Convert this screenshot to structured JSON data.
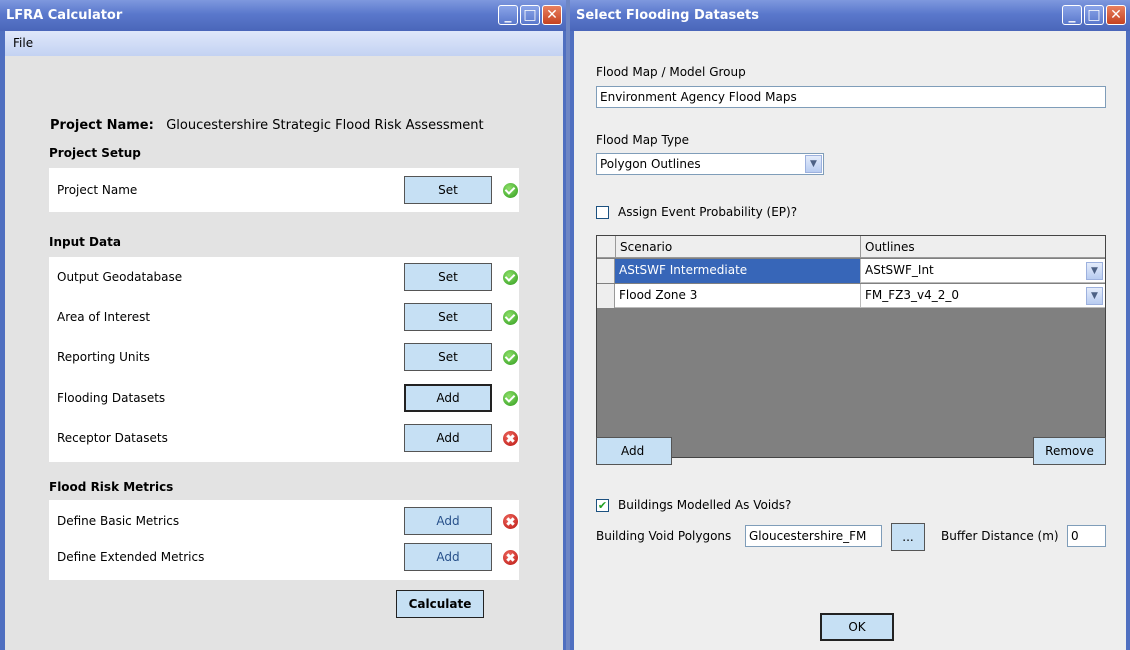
{
  "left": {
    "title": "LFRA Calculator",
    "menu": {
      "file": "File"
    },
    "project_name_label": "Project Name:",
    "project_name_value": "Gloucestershire Strategic Flood Risk Assessment",
    "sections": {
      "setup": "Project Setup",
      "input": "Input Data",
      "metrics": "Flood Risk Metrics"
    },
    "setup_rows": [
      {
        "label": "Project Name",
        "button": "Set",
        "status": "ok"
      }
    ],
    "input_rows": [
      {
        "label": "Output Geodatabase",
        "button": "Set",
        "status": "ok"
      },
      {
        "label": "Area of Interest",
        "button": "Set",
        "status": "ok"
      },
      {
        "label": "Reporting Units",
        "button": "Set",
        "status": "ok"
      },
      {
        "label": "Flooding Datasets",
        "button": "Add",
        "status": "ok"
      },
      {
        "label": "Receptor Datasets",
        "button": "Add",
        "status": "error"
      }
    ],
    "metric_rows": [
      {
        "label": "Define Basic Metrics",
        "button": "Add",
        "status": "error"
      },
      {
        "label": "Define Extended Metrics",
        "button": "Add",
        "status": "error"
      }
    ],
    "calculate": "Calculate"
  },
  "right": {
    "title": "Select Flooding Datasets",
    "group_label": "Flood Map / Model Group",
    "group_value": "Environment Agency Flood Maps",
    "type_label": "Flood Map Type",
    "type_value": "Polygon Outlines",
    "assign_ep_label": "Assign Event Probability (EP)?",
    "assign_ep_checked": false,
    "table": {
      "headers": [
        "Scenario",
        "Outlines"
      ],
      "rows": [
        {
          "scenario": "AStSWF Intermediate",
          "outline": "AStSWF_Int",
          "selected": true
        },
        {
          "scenario": "Flood Zone 3",
          "outline": "FM_FZ3_v4_2_0",
          "selected": false
        }
      ]
    },
    "add": "Add",
    "remove": "Remove",
    "voids_label": "Buildings Modelled As Voids?",
    "voids_checked": true,
    "void_polygons_label": "Building Void Polygons",
    "void_polygons_value": "Gloucestershire_FM",
    "browse": "...",
    "buffer_label": "Buffer Distance (m)",
    "buffer_value": "0",
    "ok": "OK"
  },
  "icons": {
    "minimize": "minimize-icon",
    "maximize": "maximize-icon",
    "close": "close-icon",
    "ok_status": "check-circle-icon",
    "error_status": "x-circle-icon",
    "dropdown": "chevron-down-icon"
  }
}
